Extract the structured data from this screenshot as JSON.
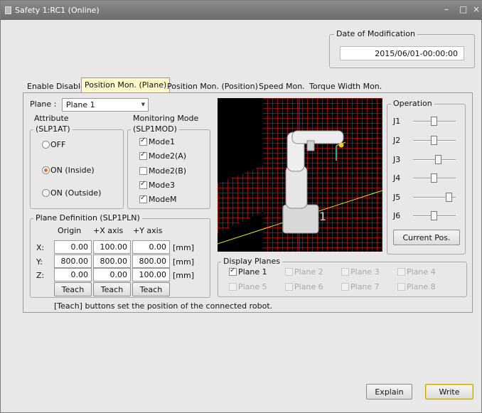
{
  "window": {
    "title": "Safety 1:RC1 (Online)",
    "minimize": "–",
    "maximize": "□",
    "close": "×"
  },
  "modification": {
    "legend": "Date of Modification",
    "value": "2015/06/01-00:00:00"
  },
  "tabs": [
    {
      "label": "Enable Disable",
      "active": false
    },
    {
      "label": "Position Mon. (Plane)",
      "active": true
    },
    {
      "label": "Position Mon. (Position)",
      "active": false
    },
    {
      "label": "Speed Mon.",
      "active": false
    },
    {
      "label": "Torque Width Mon.",
      "active": false
    }
  ],
  "plane": {
    "label": "Plane :",
    "selected": "Plane 1"
  },
  "attribute": {
    "heading": "Attribute",
    "legend": "(SLP1AT)",
    "options": [
      {
        "label": "OFF",
        "selected": false
      },
      {
        "label": "ON (Inside)",
        "selected": true
      },
      {
        "label": "ON (Outside)",
        "selected": false
      }
    ]
  },
  "monitoring": {
    "heading": "Monitoring Mode",
    "legend": "(SLP1MOD)",
    "modes": [
      {
        "label": "Mode1",
        "checked": true
      },
      {
        "label": "Mode2(A)",
        "checked": true
      },
      {
        "label": "Mode2(B)",
        "checked": false
      },
      {
        "label": "Mode3",
        "checked": true
      },
      {
        "label": "ModeM",
        "checked": true
      }
    ]
  },
  "plane_def": {
    "legend": "Plane Definition (SLP1PLN)",
    "columns": [
      "Origin",
      "+X axis",
      "+Y axis"
    ],
    "unit": "[mm]",
    "rows": [
      {
        "axis": "X:",
        "values": [
          "0.00",
          "100.00",
          "0.00"
        ]
      },
      {
        "axis": "Y:",
        "values": [
          "800.00",
          "800.00",
          "800.00"
        ]
      },
      {
        "axis": "Z:",
        "values": [
          "0.00",
          "0.00",
          "100.00"
        ]
      }
    ],
    "teach_label": "Teach",
    "note": "[Teach] buttons set the position of the connected robot."
  },
  "display_planes": {
    "legend": "Display Planes",
    "items": [
      {
        "label": "Plane 1",
        "checked": true,
        "enabled": true
      },
      {
        "label": "Plane 2",
        "checked": false,
        "enabled": false
      },
      {
        "label": "Plane 3",
        "checked": false,
        "enabled": false
      },
      {
        "label": "Plane 4",
        "checked": false,
        "enabled": false
      },
      {
        "label": "Plane 5",
        "checked": false,
        "enabled": false
      },
      {
        "label": "Plane 6",
        "checked": false,
        "enabled": false
      },
      {
        "label": "Plane 7",
        "checked": false,
        "enabled": false
      },
      {
        "label": "Plane 8",
        "checked": false,
        "enabled": false
      }
    ]
  },
  "operation": {
    "legend": "Operation",
    "joints": [
      {
        "label": "J1",
        "level": 0.5
      },
      {
        "label": "J2",
        "level": 0.5
      },
      {
        "label": "J3",
        "level": 0.6
      },
      {
        "label": "J4",
        "level": 0.5
      },
      {
        "label": "J5",
        "level": 0.85
      },
      {
        "label": "J6",
        "level": 0.5
      }
    ],
    "current_pos_label": "Current Pos."
  },
  "viewport": {
    "plane_color": "#ff2020",
    "axis_label_1": "1"
  },
  "footer": {
    "explain_label": "Explain",
    "write_label": "Write"
  }
}
